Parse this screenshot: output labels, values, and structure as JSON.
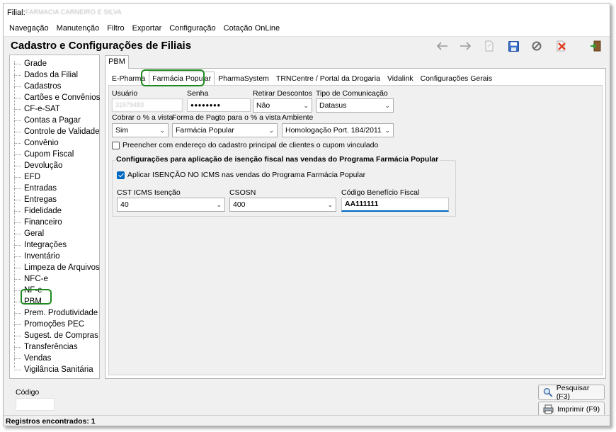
{
  "window": {
    "filial_label": "Filial:",
    "filial_value": "FARMACIA CARNEIRO E SILVA"
  },
  "menu": [
    "Navegação",
    "Manutenção",
    "Filtro",
    "Exportar",
    "Configuração",
    "Cotação OnLine"
  ],
  "page_title": "Cadastro e Configurações de Filiais",
  "toolbar_icons": [
    "arrow-left-icon",
    "arrow-right-icon",
    "new-document-icon",
    "save-icon",
    "cancel-icon",
    "delete-icon",
    "exit-icon"
  ],
  "sidebar": {
    "items": [
      "Grade",
      "Dados da Filial",
      "Cadastros",
      "Cartões e Convênios",
      "CF-e-SAT",
      "Contas a Pagar",
      "Controle de Validade",
      "Convênio",
      "Cupom Fiscal",
      "Devolução",
      "EFD",
      "Entradas",
      "Entregas",
      "Fidelidade",
      "Financeiro",
      "Geral",
      "Integrações",
      "Inventário",
      "Limpeza de Arquivos",
      "NFC-e",
      "NF-e",
      "PBM",
      "Prem. Produtividade",
      "Promoções PEC",
      "Sugest. de Compras",
      "Transferências",
      "Vendas",
      "Vigilância Sanitária"
    ],
    "selected": "PBM"
  },
  "outer_tab": "PBM",
  "subtabs": [
    "E-Pharma",
    "Farmácia Popular",
    "PharmaSystem",
    "TRNCentre / Portal da Drogaria",
    "Vidalink",
    "Configurações Gerais"
  ],
  "active_subtab": "Farmácia Popular",
  "form": {
    "usuario_label": "Usuário",
    "usuario_value": "31979483",
    "senha_label": "Senha",
    "senha_value": "●●●●●●●●",
    "retirar_label": "Retirar Descontos",
    "retirar_value": "Não",
    "tipo_label": "Tipo de Comunicação",
    "tipo_value": "Datasus",
    "cobrar_label": "Cobrar o % a vista",
    "cobrar_value": "Sim",
    "forma_label": "Forma de Pagto para o % a vista",
    "forma_value": "Farmácia Popular",
    "ambiente_label": "Ambiente",
    "ambiente_value": "Homologação Port. 184/2011",
    "preencher_label": "Preencher com endereço do cadastro principal de clientes o cupom vinculado",
    "preencher_checked": false
  },
  "group": {
    "title": "Configurações para aplicação de isenção fiscal nas vendas do Programa Farmácia Popular",
    "aplicar_label": "Aplicar ISENÇÃO NO ICMS nas vendas do Programa Farmácia Popular",
    "aplicar_checked": true,
    "cst_label": "CST ICMS Isenção",
    "cst_value": "40",
    "csosn_label": "CSOSN",
    "csosn_value": "400",
    "codigo_label": "Código Benefício Fiscal",
    "codigo_value": "AA111111"
  },
  "bottom": {
    "codigo_label": "Código",
    "codigo_value": "",
    "pesquisar_label": "Pesquisar (F3)",
    "imprimir_label": "Imprimir (F9)"
  },
  "status": "Registros encontrados: 1",
  "colors": {
    "highlight": "#1c8a1c",
    "checkbox": "#0067c0"
  }
}
